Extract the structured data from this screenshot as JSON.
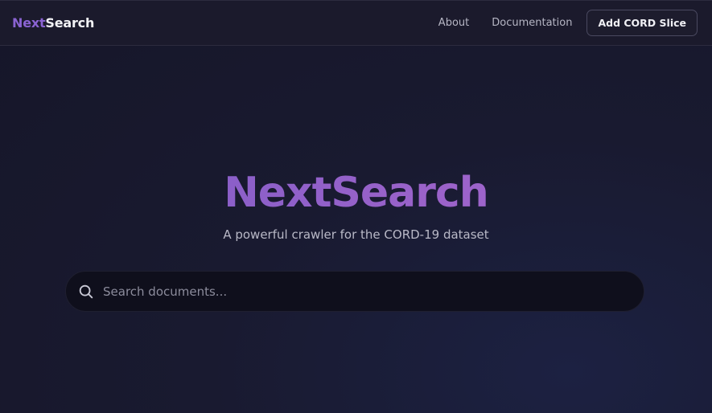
{
  "header": {
    "brand": {
      "part1": "Next",
      "part2": "Search"
    },
    "nav": {
      "about": "About",
      "documentation": "Documentation",
      "add_slice": "Add CORD Slice"
    }
  },
  "hero": {
    "title": "NextSearch",
    "subtitle": "A powerful crawler for the CORD-19 dataset"
  },
  "search": {
    "value": "",
    "placeholder": "Search documents...",
    "icon": "search-icon"
  },
  "colors": {
    "accent": "#8a63d2",
    "background": "#191a30",
    "navbar": "#1b1a2c",
    "search_bg": "#0f0f1c"
  }
}
